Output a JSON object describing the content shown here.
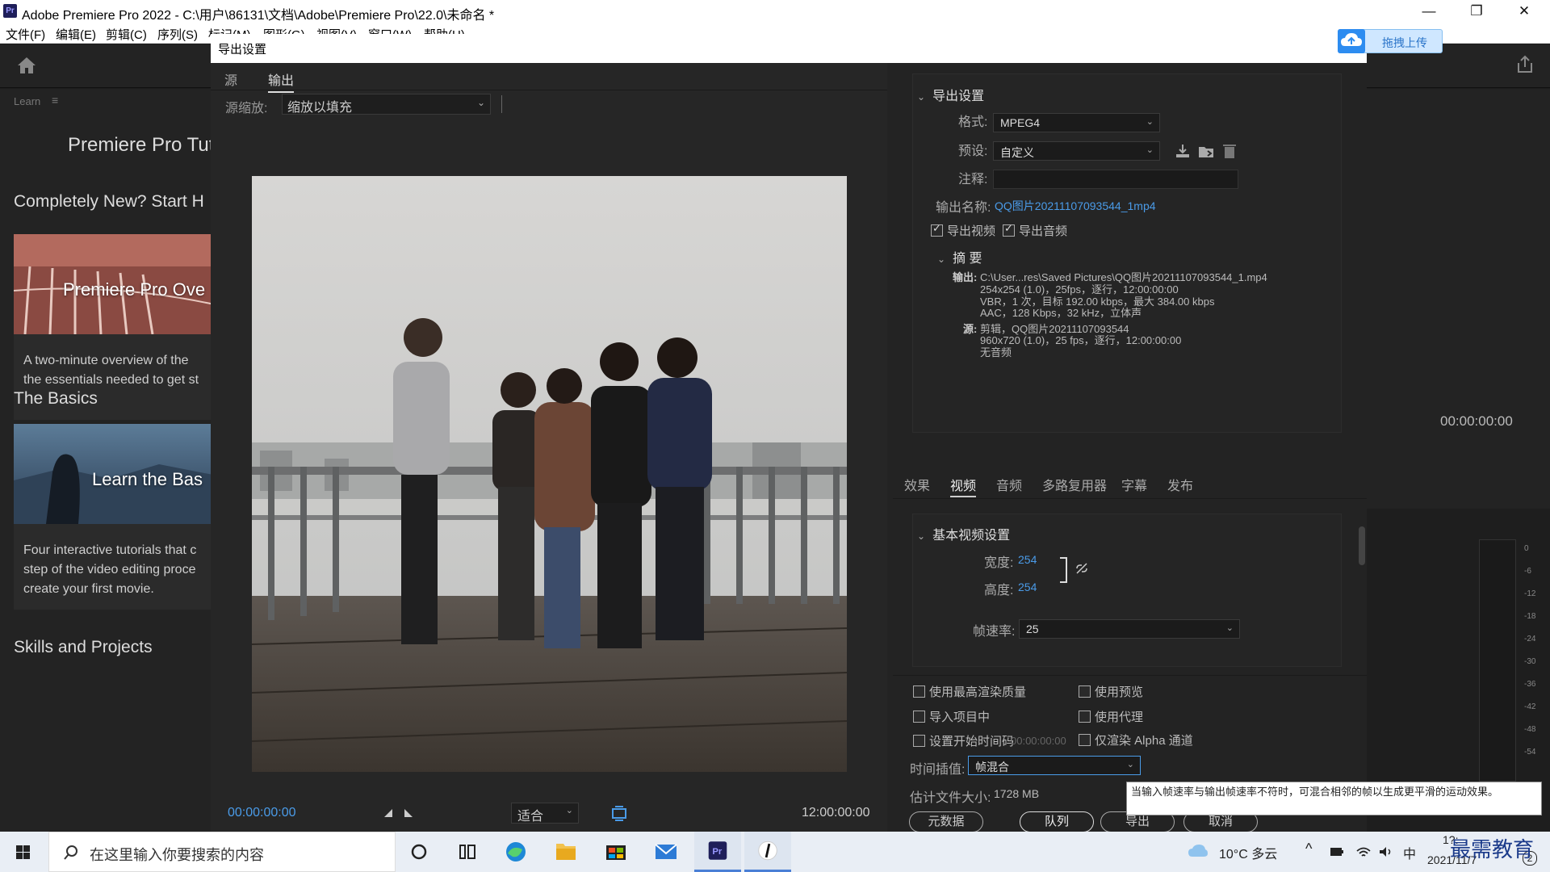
{
  "window": {
    "title": "Adobe Premiere Pro 2022 - C:\\用户\\86131\\文档\\Adobe\\Premiere Pro\\22.0\\未命名 *",
    "app_icon": "Pr",
    "controls": {
      "minimize": "—",
      "maximize": "❐",
      "close": "✕"
    }
  },
  "menubar": {
    "items": [
      "文件(F)",
      "编辑(E)",
      "剪辑(C)",
      "序列(S)",
      "标记(M)",
      "图形(G)",
      "视图(V)",
      "窗口(W)",
      "帮助(H)"
    ]
  },
  "learn_panel": {
    "tab_label": "Learn",
    "tab_menu": "≡",
    "title": "Premiere Pro Tut",
    "section_new": "Completely New? Start H",
    "card1": {
      "thumb_label": "Premiere Pro Ove",
      "desc": "A two-minute overview of the\nthe essentials needed to get st"
    },
    "section_basics": "The Basics",
    "card2": {
      "thumb_label": "Learn the Bas",
      "desc": "Four interactive tutorials that c\nstep of the video editing proce\ncreate your first movie."
    },
    "section_skills": "Skills and Projects"
  },
  "pr_right": {
    "timecode": "00:00:00:00",
    "meter_labels": [
      "0",
      "-6",
      "-12",
      "-18",
      "-24",
      "-30",
      "-36",
      "-42",
      "-48",
      "-54"
    ]
  },
  "upload_widget": {
    "label": "拖拽上传"
  },
  "dialog": {
    "title": "导出设置",
    "preview": {
      "tabs": [
        "源",
        "输出"
      ],
      "active_tab": "输出",
      "scale_label": "源缩放:",
      "scale_value": "缩放以填充",
      "timecode_in": "00:00:00:00",
      "timecode_out": "12:00:00:00",
      "fit_value": "适合",
      "playhead_position": 0.0
    },
    "export_settings": {
      "heading": "导出设置",
      "format_label": "格式:",
      "format_value": "MPEG4",
      "preset_label": "预设:",
      "preset_value": "自定义",
      "comment_label": "注释:",
      "comment_value": "",
      "output_name_label": "输出名称:",
      "output_name_value": "QQ图片20211107093544_1mp4",
      "export_video_label": "导出视频",
      "export_video_checked": true,
      "export_audio_label": "导出音频",
      "export_audio_checked": true,
      "summary_heading": "摘 要",
      "summary_output_label": "输出:",
      "summary_output_lines": [
        "C:\\User...res\\Saved  Pictures\\QQ图片20211107093544_1.mp4",
        "254x254 (1.0)，25fps，逐行，12:00:00:00",
        "VBR，1 次，目标 192.00 kbps，最大 384.00 kbps",
        "AAC，128 Kbps，32  kHz，立体声"
      ],
      "summary_source_label": "源:",
      "summary_source_lines": [
        "剪辑，QQ图片20211107093544",
        "960x720 (1.0)，25 fps，逐行，12:00:00:00",
        "无音频"
      ]
    },
    "settings_tabs": [
      "效果",
      "视频",
      "音频",
      "多路复用器",
      "字幕",
      "发布"
    ],
    "active_settings_tab": "视频",
    "video": {
      "heading": "基本视频设置",
      "width_label": "宽度:",
      "width_value": "254",
      "height_label": "高度:",
      "height_value": "254",
      "framerate_label": "帧速率:",
      "framerate_value": "25"
    },
    "options": {
      "max_render_quality": "使用最高渲染质量",
      "use_previews": "使用预览",
      "import_into_project": "导入项目中",
      "use_proxies": "使用代理",
      "set_start_timecode": "设置开始时间码",
      "start_timecode_value": "00:00:00:00",
      "render_alpha_only": "仅渲染 Alpha 通道",
      "time_interp_label": "时间插值:",
      "time_interp_value": "帧混合",
      "est_size_label": "估计文件大小:",
      "est_size_value": "1728 MB"
    },
    "buttons": {
      "metadata": "元数据",
      "queue": "队列",
      "export": "导出",
      "cancel": "取消"
    },
    "tooltip": "当输入帧速率与输出帧速率不符时，可混合相邻的帧以生成更平滑的运动效果。"
  },
  "taskbar": {
    "search_placeholder": "在这里输入你要搜索的内容",
    "weather": "10°C 多云",
    "ime": "中",
    "time": "1?:",
    "date": "2021/11/7",
    "notification_count": "2",
    "watermark": "最需教育"
  }
}
